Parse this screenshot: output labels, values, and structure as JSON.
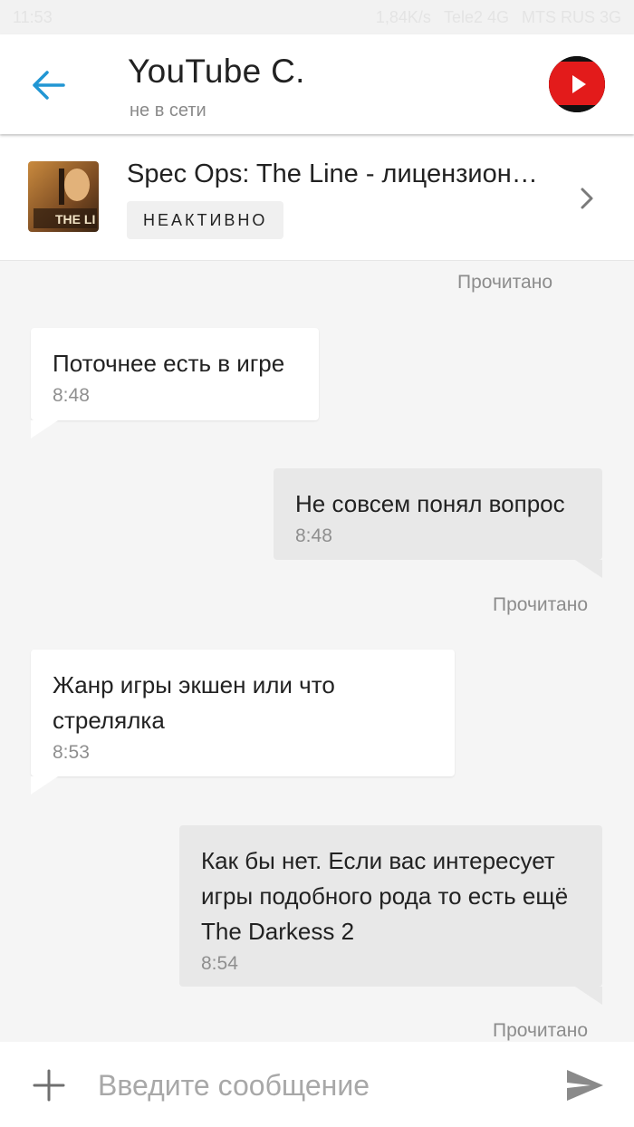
{
  "status_bar": {
    "time": "11:53",
    "network_speed": "1,84K/s",
    "carrier_1": "Tele2 4G",
    "carrier_2": "MTS RUS 3G"
  },
  "header": {
    "contact_name": "YouTube C.",
    "contact_status": "не в сети"
  },
  "listing": {
    "title": "Spec Ops: The Line - лицензион…",
    "status_badge": "НЕАКТИВНО"
  },
  "messages": [
    {
      "direction": "out",
      "read_label": "Прочитано"
    },
    {
      "direction": "in",
      "text": "Поточнее есть в игре",
      "time": "8:48"
    },
    {
      "direction": "out",
      "text": "Не совсем понял вопрос",
      "time": "8:48",
      "read_label": "Прочитано"
    },
    {
      "direction": "in",
      "text": "Жанр игры экшен или что стрелялка",
      "time": "8:53"
    },
    {
      "direction": "out",
      "text": "Как бы нет. Если вас интересует игры подобного рода то есть ещё The Darkess 2",
      "time": "8:54",
      "read_label": "Прочитано"
    }
  ],
  "composer": {
    "placeholder": "Введите сообщение"
  },
  "colors": {
    "accent": "#2196d3",
    "incoming_bubble": "#ffffff",
    "outgoing_bubble": "#e8e8e8",
    "background": "#f5f5f5"
  }
}
